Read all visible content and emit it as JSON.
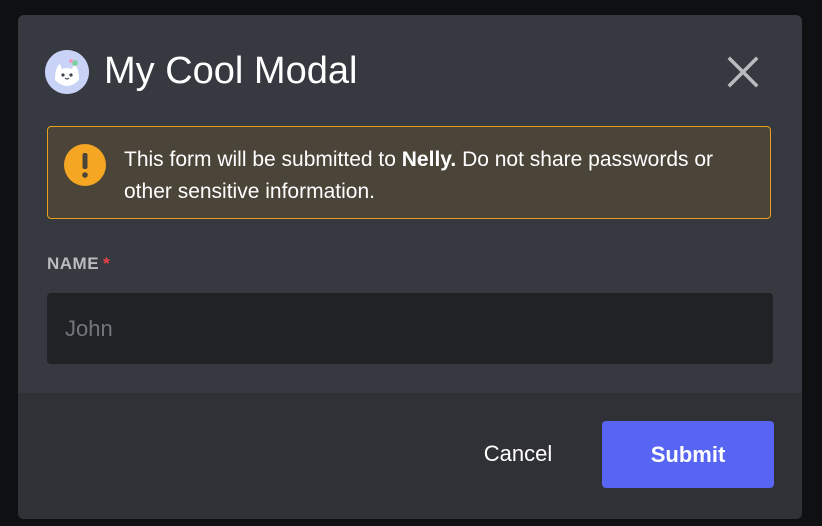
{
  "modal": {
    "title": "My Cool Modal",
    "avatar_icon": "cat-face-icon",
    "close_icon": "close-icon"
  },
  "warning": {
    "icon": "exclamation-icon",
    "text_before": "This form will be submitted to ",
    "app_name": "Nelly.",
    "text_after": " Do not share passwords or other sensitive information."
  },
  "form": {
    "name_label": "NAME",
    "required_marker": "*",
    "name_placeholder": "John",
    "name_value": ""
  },
  "footer": {
    "cancel_label": "Cancel",
    "submit_label": "Submit"
  },
  "colors": {
    "backdrop": "#0f1012",
    "modal_bg": "#36393f",
    "footer_bg": "#2f3136",
    "input_bg": "#202225",
    "warning_border": "#e6a11b",
    "warning_bg": "#4b4539",
    "warning_icon": "#f5a623",
    "submit_bg": "#5865f2",
    "required": "#ed4245"
  }
}
